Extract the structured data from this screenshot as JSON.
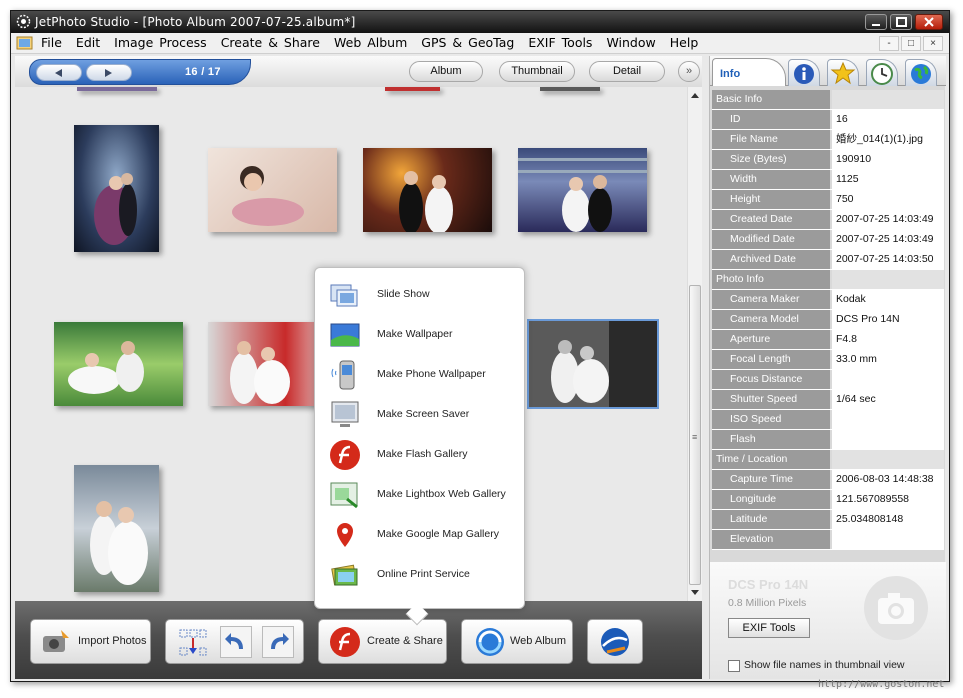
{
  "window": {
    "title": "JetPhoto Studio - [Photo Album 2007-07-25.album*]"
  },
  "menu": [
    "File",
    "Edit",
    "Image Process",
    "Create & Share",
    "Web Album",
    "GPS & GeoTag",
    "EXIF Tools",
    "Window",
    "Help"
  ],
  "mdi_controls": [
    "-",
    "□",
    "×"
  ],
  "nav": {
    "counter": "16 / 17",
    "tabs": [
      "Album",
      "Thumbnail",
      "Detail"
    ],
    "more": "»"
  },
  "popup_menu": [
    "Slide Show",
    "Make Wallpaper",
    "Make Phone Wallpaper",
    "Make Screen Saver",
    "Make Flash Gallery",
    "Make Lightbox Web Gallery",
    "Make Google Map Gallery",
    "Online Print Service"
  ],
  "bottom_toolbar": {
    "import": "Import Photos",
    "create_share": "Create & Share",
    "web_album": "Web Album"
  },
  "info_panel": {
    "tab_label": "Info",
    "sections": {
      "basic": "Basic Info",
      "photo": "Photo Info",
      "time": "Time / Location"
    },
    "basic": [
      {
        "k": "ID",
        "v": "16"
      },
      {
        "k": "File Name",
        "v": "婚紗_014(1)(1).jpg"
      },
      {
        "k": "Size (Bytes)",
        "v": "190910"
      },
      {
        "k": "Width",
        "v": "1125"
      },
      {
        "k": "Height",
        "v": "750"
      },
      {
        "k": "Created Date",
        "v": "2007-07-25 14:03:49"
      },
      {
        "k": "Modified Date",
        "v": "2007-07-25 14:03:49"
      },
      {
        "k": "Archived Date",
        "v": "2007-07-25 14:03:50"
      }
    ],
    "photo": [
      {
        "k": "Camera Maker",
        "v": "Kodak"
      },
      {
        "k": "Camera Model",
        "v": "DCS Pro 14N"
      },
      {
        "k": "Aperture",
        "v": "F4.8"
      },
      {
        "k": "Focal Length",
        "v": "33.0 mm"
      },
      {
        "k": "Focus Distance",
        "v": ""
      },
      {
        "k": "Shutter Speed",
        "v": "1/64 sec"
      },
      {
        "k": "ISO Speed",
        "v": ""
      },
      {
        "k": "Flash",
        "v": ""
      }
    ],
    "time": [
      {
        "k": "Capture Time",
        "v": "2006-08-03 14:48:38"
      },
      {
        "k": "Longitude",
        "v": "121.567089558"
      },
      {
        "k": "Latitude",
        "v": "25.034808148"
      },
      {
        "k": "Elevation",
        "v": ""
      }
    ],
    "camera_name": "DCS Pro 14N",
    "camera_pixels": "0.8 Million Pixels",
    "exif_button": "EXIF Tools",
    "show_filenames_label": "Show file names in thumbnail view"
  },
  "watermark": "http://www.goston.net"
}
